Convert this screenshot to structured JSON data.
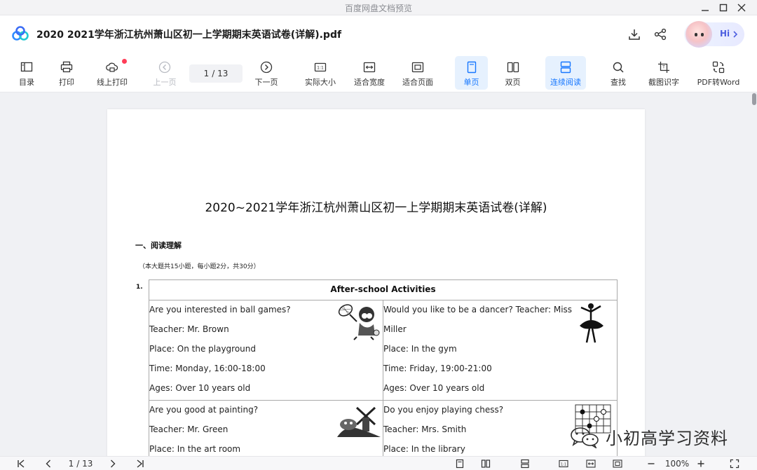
{
  "window": {
    "title": "百度网盘文档预览"
  },
  "header": {
    "filename": "2020  2021学年浙江杭州萧山区初一上学期期末英语试卷(详解).pdf",
    "hi_label": "Hi"
  },
  "toolbar": {
    "toc": "目录",
    "print": "打印",
    "online_print": "线上打印",
    "prev_page": "上一页",
    "page_current": "1",
    "page_total": "/ 13",
    "next_page": "下一页",
    "actual_size": "实际大小",
    "fit_width": "适合宽度",
    "fit_page": "适合页面",
    "single_page": "单页",
    "double_page": "双页",
    "continuous": "连续阅读",
    "find": "查找",
    "ocr": "截图识字",
    "pdf_to_word": "PDF转Word"
  },
  "document": {
    "title": "2020~2021学年浙江杭州萧山区初一上学期期末英语试卷(详解)",
    "section_title": "一、阅读理解",
    "section_note": "（本大题共15小题，每小题2分，共30分）",
    "question_number": "1.",
    "table": {
      "header": "After-school Activities",
      "cells": [
        {
          "lines": [
            "Are you interested in ball games?",
            "Teacher: Mr. Brown",
            "Place: On the playground",
            "Time: Monday, 16:00-18:00",
            "Ages: Over 10 years old"
          ]
        },
        {
          "lines": [
            "Would you like to be a dancer? Teacher: Miss",
            "Miller",
            "Place: In the gym",
            "Time: Friday, 19:00-21:00",
            "Ages: Over 10 years old"
          ]
        },
        {
          "lines": [
            "Are you good at painting?",
            "Teacher: Mr. Green",
            "Place: In the art room"
          ]
        },
        {
          "lines": [
            "Do you enjoy playing chess?",
            "Teacher: Mrs. Smith",
            "Place: In the library"
          ]
        }
      ]
    }
  },
  "statusbar": {
    "page_current": "1",
    "page_total": "/ 13",
    "zoom": "100%"
  },
  "watermark": {
    "text": "小初高学习资料"
  }
}
